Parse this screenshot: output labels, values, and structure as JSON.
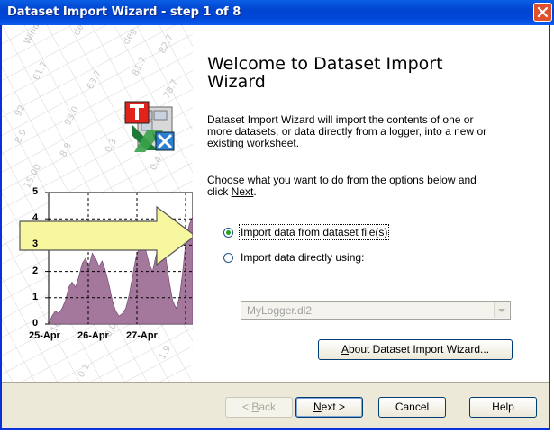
{
  "window": {
    "title": "Dataset Import Wizard - step 1 of 8"
  },
  "page": {
    "heading_line1": "Welcome to Dataset Import",
    "heading_line2": "Wizard",
    "intro_line1": "Dataset Import Wizard will import the contents of one or",
    "intro_line2": "more datasets, or data directly from a logger, into a new or",
    "intro_line3": "existing worksheet.",
    "choose_line1": "Choose what you want to do from the options below and",
    "choose_prefix": "click ",
    "choose_link": "Next",
    "choose_suffix": "."
  },
  "options": {
    "import_file_label": "Import data from dataset file(s)",
    "import_file_selected": true,
    "import_logger_label": "Import data directly using:",
    "import_logger_selected": false,
    "logger_select_value": "MyLogger.dl2"
  },
  "buttons": {
    "about_prefix": "",
    "about_u": "A",
    "about_rest": "bout Dataset Import Wizard...",
    "back_prefix": "< ",
    "back_u": "B",
    "back_rest": "ack",
    "next_u": "N",
    "next_rest": "ext >",
    "cancel": "Cancel",
    "help": "Help"
  },
  "side_chart": {
    "y_ticks": [
      "5",
      "4",
      "3",
      "2",
      "1",
      "0"
    ],
    "x_ticks": [
      "25-Apr",
      "26-Apr",
      "27-Apr"
    ],
    "bg_table_text": [
      "WindDir",
      "deg",
      "deg",
      "82.7",
      "61.7",
      "63.7",
      "81.7",
      "78.7",
      "92",
      "93.0",
      "91.9",
      "8.9",
      "8.8",
      "0.3",
      "0.4",
      "15:00",
      "16:00",
      "0.0",
      "1.9",
      "0.1"
    ]
  },
  "colors": {
    "titlebar": "#0046d8",
    "arrow_fill": "#f7f7a0",
    "area_fill": "#a3789c",
    "close": "#e0502a"
  }
}
